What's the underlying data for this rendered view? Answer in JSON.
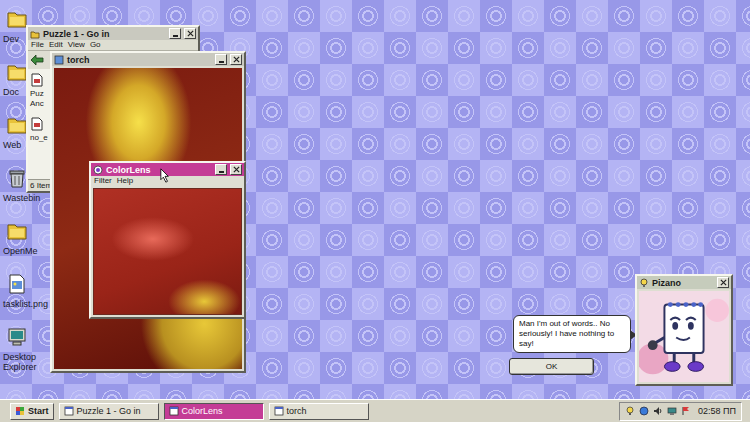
{
  "desktop_icons": [
    {
      "label": "Dev",
      "kind": "folder"
    },
    {
      "label": "Doc",
      "kind": "folder"
    },
    {
      "label": "Web",
      "kind": "folder"
    },
    {
      "label": "Wastebin",
      "kind": "bin"
    },
    {
      "label": "OpenMe",
      "kind": "folder"
    },
    {
      "label": "tasklist.png",
      "kind": "note"
    },
    {
      "label": "Desktop Explorer",
      "kind": "computer"
    }
  ],
  "windows": {
    "puzzle": {
      "title": "Puzzle 1 - Go in",
      "active": false,
      "menu": [
        "File",
        "Edit",
        "View",
        "Go"
      ],
      "items": [
        {
          "lines": [
            "Puz",
            "Anc"
          ]
        },
        {
          "lines": [
            "no_e"
          ]
        }
      ],
      "status": "6 Item"
    },
    "torch": {
      "title": "torch",
      "active": false
    },
    "colorlens": {
      "title": "ColorLens",
      "active": true,
      "menu": [
        "Filter",
        "Help"
      ]
    },
    "pizano": {
      "title": "Pizano",
      "active": false,
      "message": "Man I'm out of words.. No seriously! I have nothing to say!",
      "button": "OK"
    }
  },
  "taskbar": {
    "start": "Start",
    "tasks": [
      {
        "label": "Puzzle 1 - Go in",
        "selected": false
      },
      {
        "label": "ColorLens",
        "selected": true
      },
      {
        "label": "torch",
        "selected": false
      }
    ],
    "clock": "02:58 ПП"
  }
}
